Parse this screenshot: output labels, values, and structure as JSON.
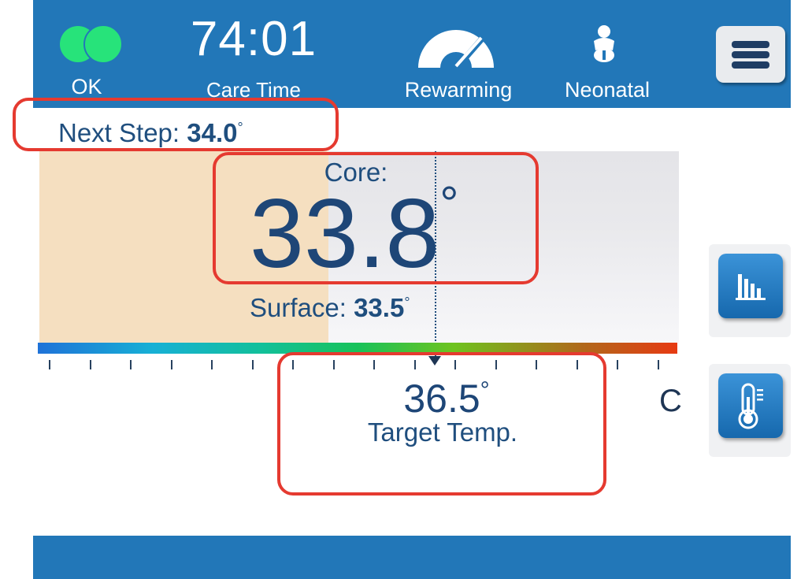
{
  "header": {
    "status_label": "OK",
    "care_time": "74:01",
    "care_time_label": "Care Time",
    "mode_label": "Rewarming",
    "patient_label": "Neonatal",
    "menu_icon": "hamburger-menu-icon"
  },
  "next_step": {
    "label": "Next Step:",
    "value": "34.0",
    "degree": "°"
  },
  "core": {
    "label": "Core:",
    "value": "33.8",
    "degree": "°"
  },
  "surface": {
    "label": "Surface:",
    "value": "33.5",
    "degree": "°"
  },
  "target": {
    "value": "36.5",
    "degree": "°",
    "label": "Target Temp.",
    "unit": "C"
  },
  "side_buttons": {
    "chart_icon": "bar-chart-icon",
    "thermometer_icon": "thermometer-icon"
  },
  "colors": {
    "header_blue": "#2277b8",
    "status_ok": "#27e37a",
    "text_navy": "#1e4677",
    "highlight_red": "#e53a30",
    "warm_zone": "#f5dfc0"
  }
}
